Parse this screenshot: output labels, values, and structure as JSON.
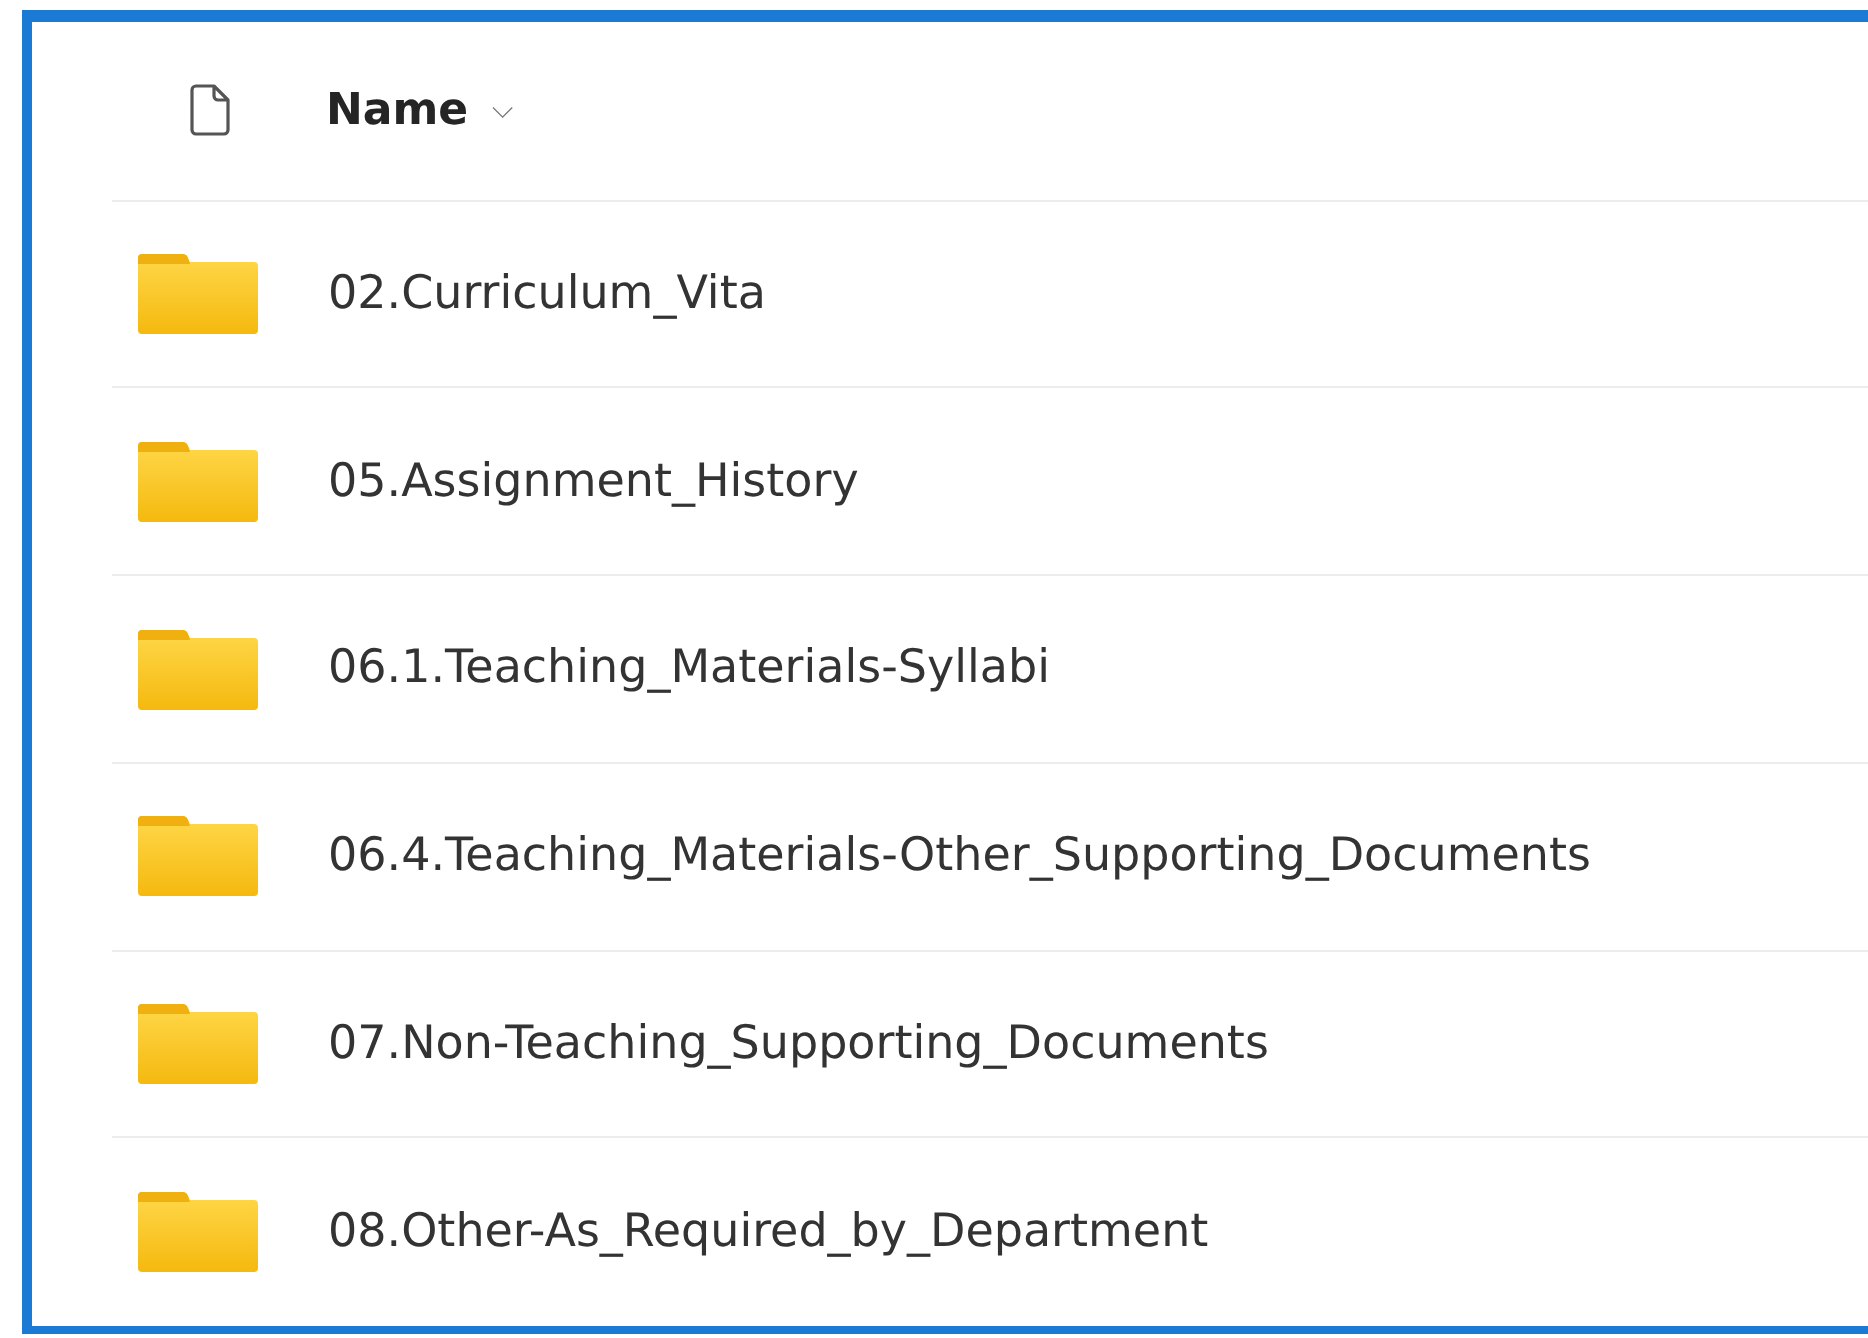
{
  "header": {
    "column": "Name",
    "sort_glyph": "⌵"
  },
  "rows": [
    {
      "name": "02.Curriculum_Vita"
    },
    {
      "name": "05.Assignment_History"
    },
    {
      "name": "06.1.Teaching_Materials-Syllabi"
    },
    {
      "name": "06.4.Teaching_Materials-Other_Supporting_Documents"
    },
    {
      "name": "07.Non-Teaching_Supporting_Documents"
    },
    {
      "name": "08.Other-As_Required_by_Department"
    }
  ]
}
